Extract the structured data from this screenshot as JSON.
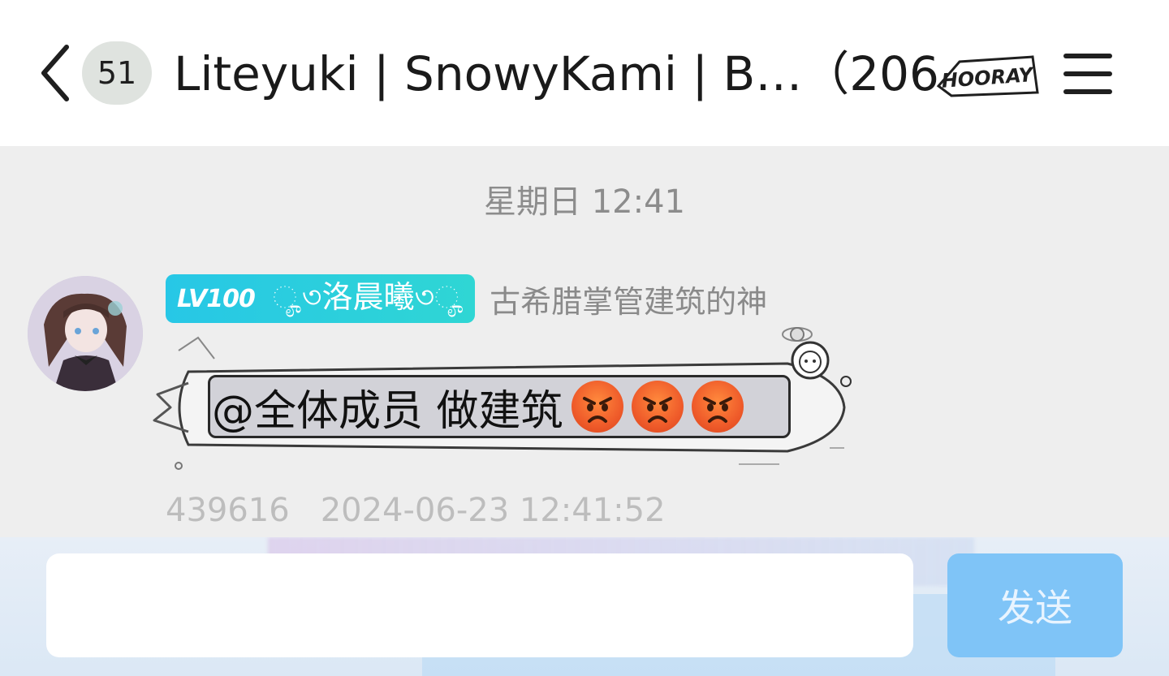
{
  "header": {
    "unread_count": "51",
    "title": "Liteyuki | SnowyKami | B…（206）",
    "badge_text": "HOORAY"
  },
  "chat": {
    "time_divider": "星期日 12:41",
    "message": {
      "level": "LV100",
      "nickname": "ೄ৩洛晨曦৩ೄ",
      "member_title": "古希腊掌管建筑的神",
      "text": "@全体成员 做建筑",
      "emojis": [
        "angry-face",
        "angry-face",
        "angry-face"
      ],
      "sender_id": "439616",
      "timestamp": "2024-06-23 12:41:52"
    }
  },
  "input": {
    "value": "",
    "placeholder": "",
    "send_label": "发送"
  },
  "colors": {
    "level_tag": "#27c7e6",
    "send_button": "#7fc4f7",
    "chat_bg": "#eeeeee"
  }
}
